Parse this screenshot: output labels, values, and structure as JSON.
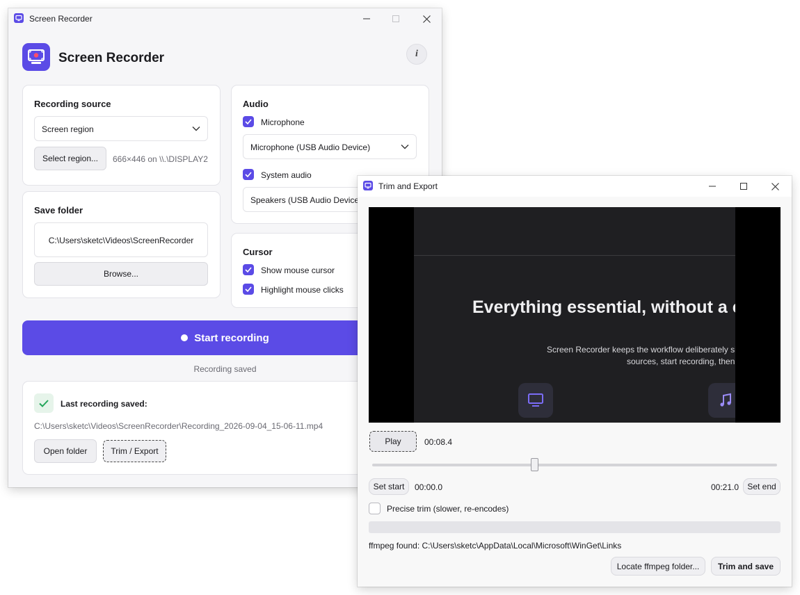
{
  "main_window": {
    "title": "Screen Recorder",
    "header_title": "Screen Recorder",
    "recording_source": {
      "title": "Recording source",
      "source_value": "Screen region",
      "select_region_label": "Select region...",
      "region_info": "666×446 on \\\\.\\DISPLAY2"
    },
    "save_folder": {
      "title": "Save folder",
      "path": "C:\\Users\\sketc\\Videos\\ScreenRecorder",
      "browse_label": "Browse..."
    },
    "audio": {
      "title": "Audio",
      "microphone_label": "Microphone",
      "microphone_checked": true,
      "microphone_device": "Microphone (USB Audio Device)",
      "system_audio_label": "System audio",
      "system_audio_checked": true,
      "speaker_device": "Speakers (USB Audio Device)"
    },
    "cursor": {
      "title": "Cursor",
      "show_cursor_label": "Show mouse cursor",
      "show_cursor_checked": true,
      "highlight_clicks_label": "Highlight mouse clicks",
      "highlight_clicks_checked": true
    },
    "start_recording_label": "Start recording",
    "status_text": "Recording saved",
    "last_recording": {
      "title": "Last recording saved:",
      "path": "C:\\Users\\sketc\\Videos\\ScreenRecorder\\Recording_2026-09-04_15-06-11.mp4",
      "open_folder_label": "Open folder",
      "trim_export_label": "Trim / Export"
    }
  },
  "trim_window": {
    "title": "Trim and Export",
    "preview": {
      "headline": "Everything essential, without a c",
      "subline_1": "Screen Recorder keeps the workflow deliberately si",
      "subline_2": "sources, start recording, then"
    },
    "play_label": "Play",
    "current_time": "00:08.4",
    "playhead_fraction": 0.4,
    "set_start_label": "Set start",
    "start_time": "00:00.0",
    "end_time": "00:21.0",
    "set_end_label": "Set end",
    "precise_trim_label": "Precise trim (slower, re-encodes)",
    "precise_trim_checked": false,
    "ffmpeg_status": "ffmpeg found: C:\\Users\\sketc\\AppData\\Local\\Microsoft\\WinGet\\Links",
    "locate_ffmpeg_label": "Locate ffmpeg folder...",
    "trim_save_label": "Trim and save"
  },
  "colors": {
    "accent": "#5b4be6",
    "success": "#22a559",
    "preview_bg": "#000000",
    "preview_inner": "#1f1f22"
  }
}
